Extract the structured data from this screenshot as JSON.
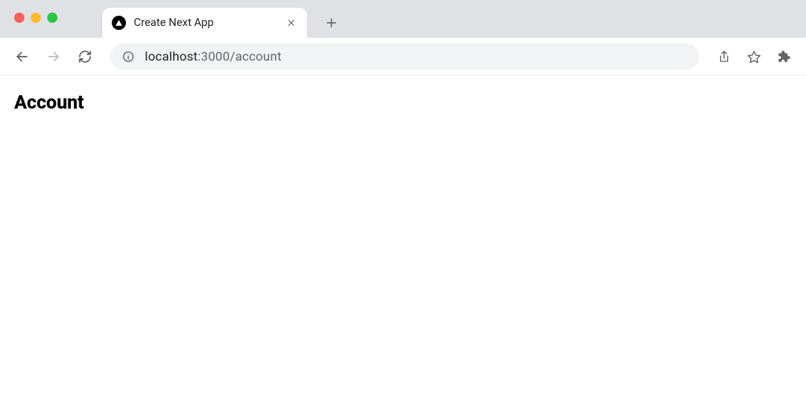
{
  "browser": {
    "tab": {
      "title": "Create Next App"
    },
    "url": {
      "host": "localhost",
      "port_path": ":3000/account"
    }
  },
  "page": {
    "heading": "Account"
  }
}
